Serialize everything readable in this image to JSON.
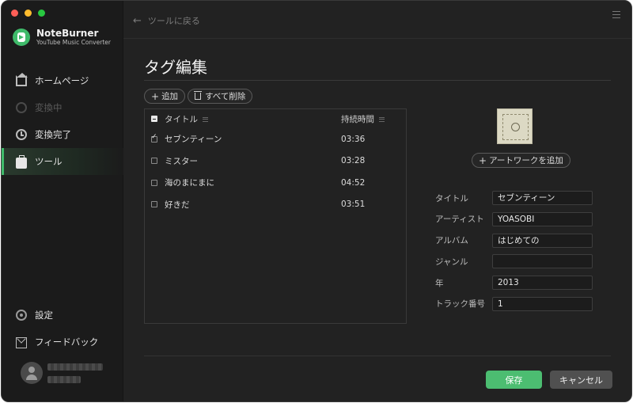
{
  "app": {
    "name": "NoteBurner",
    "subtitle": "YouTube Music Converter"
  },
  "sidebar": {
    "items": [
      {
        "label": "ホームページ",
        "icon": "home-icon",
        "state": "normal"
      },
      {
        "label": "変換中",
        "icon": "converting-icon",
        "state": "disabled"
      },
      {
        "label": "変換完了",
        "icon": "clock-icon",
        "state": "normal"
      },
      {
        "label": "ツール",
        "icon": "toolbox-icon",
        "state": "active"
      }
    ],
    "bottom_items": [
      {
        "label": "設定",
        "icon": "gear-icon"
      },
      {
        "label": "フィードバック",
        "icon": "mail-icon"
      }
    ]
  },
  "header": {
    "back_label": "ツールに戻る"
  },
  "page": {
    "title": "タグ編集"
  },
  "toolbar": {
    "add_label": "追加",
    "delete_all_label": "すべて削除"
  },
  "table": {
    "col_title": "タイトル",
    "col_duration": "持続時間",
    "rows": [
      {
        "title": "セブンティーン",
        "duration": "03:36",
        "checked": true
      },
      {
        "title": "ミスター",
        "duration": "03:28",
        "checked": false
      },
      {
        "title": "海のまにまに",
        "duration": "04:52",
        "checked": false
      },
      {
        "title": "好きだ",
        "duration": "03:51",
        "checked": false
      }
    ]
  },
  "artwork": {
    "add_label": "アートワークを追加"
  },
  "form": {
    "title_label": "タイトル",
    "title_value": "セブンティーン",
    "artist_label": "アーティスト",
    "artist_value": "YOASOBI",
    "album_label": "アルバム",
    "album_value": "はじめての",
    "genre_label": "ジャンル",
    "genre_value": "",
    "year_label": "年",
    "year_value": "2013",
    "track_label": "トラック番号",
    "track_value": "1"
  },
  "actions": {
    "save_label": "保存",
    "cancel_label": "キャンセル"
  },
  "colors": {
    "accent": "#4cbd71",
    "background": "#222222",
    "sidebar": "#1b1b1b"
  }
}
